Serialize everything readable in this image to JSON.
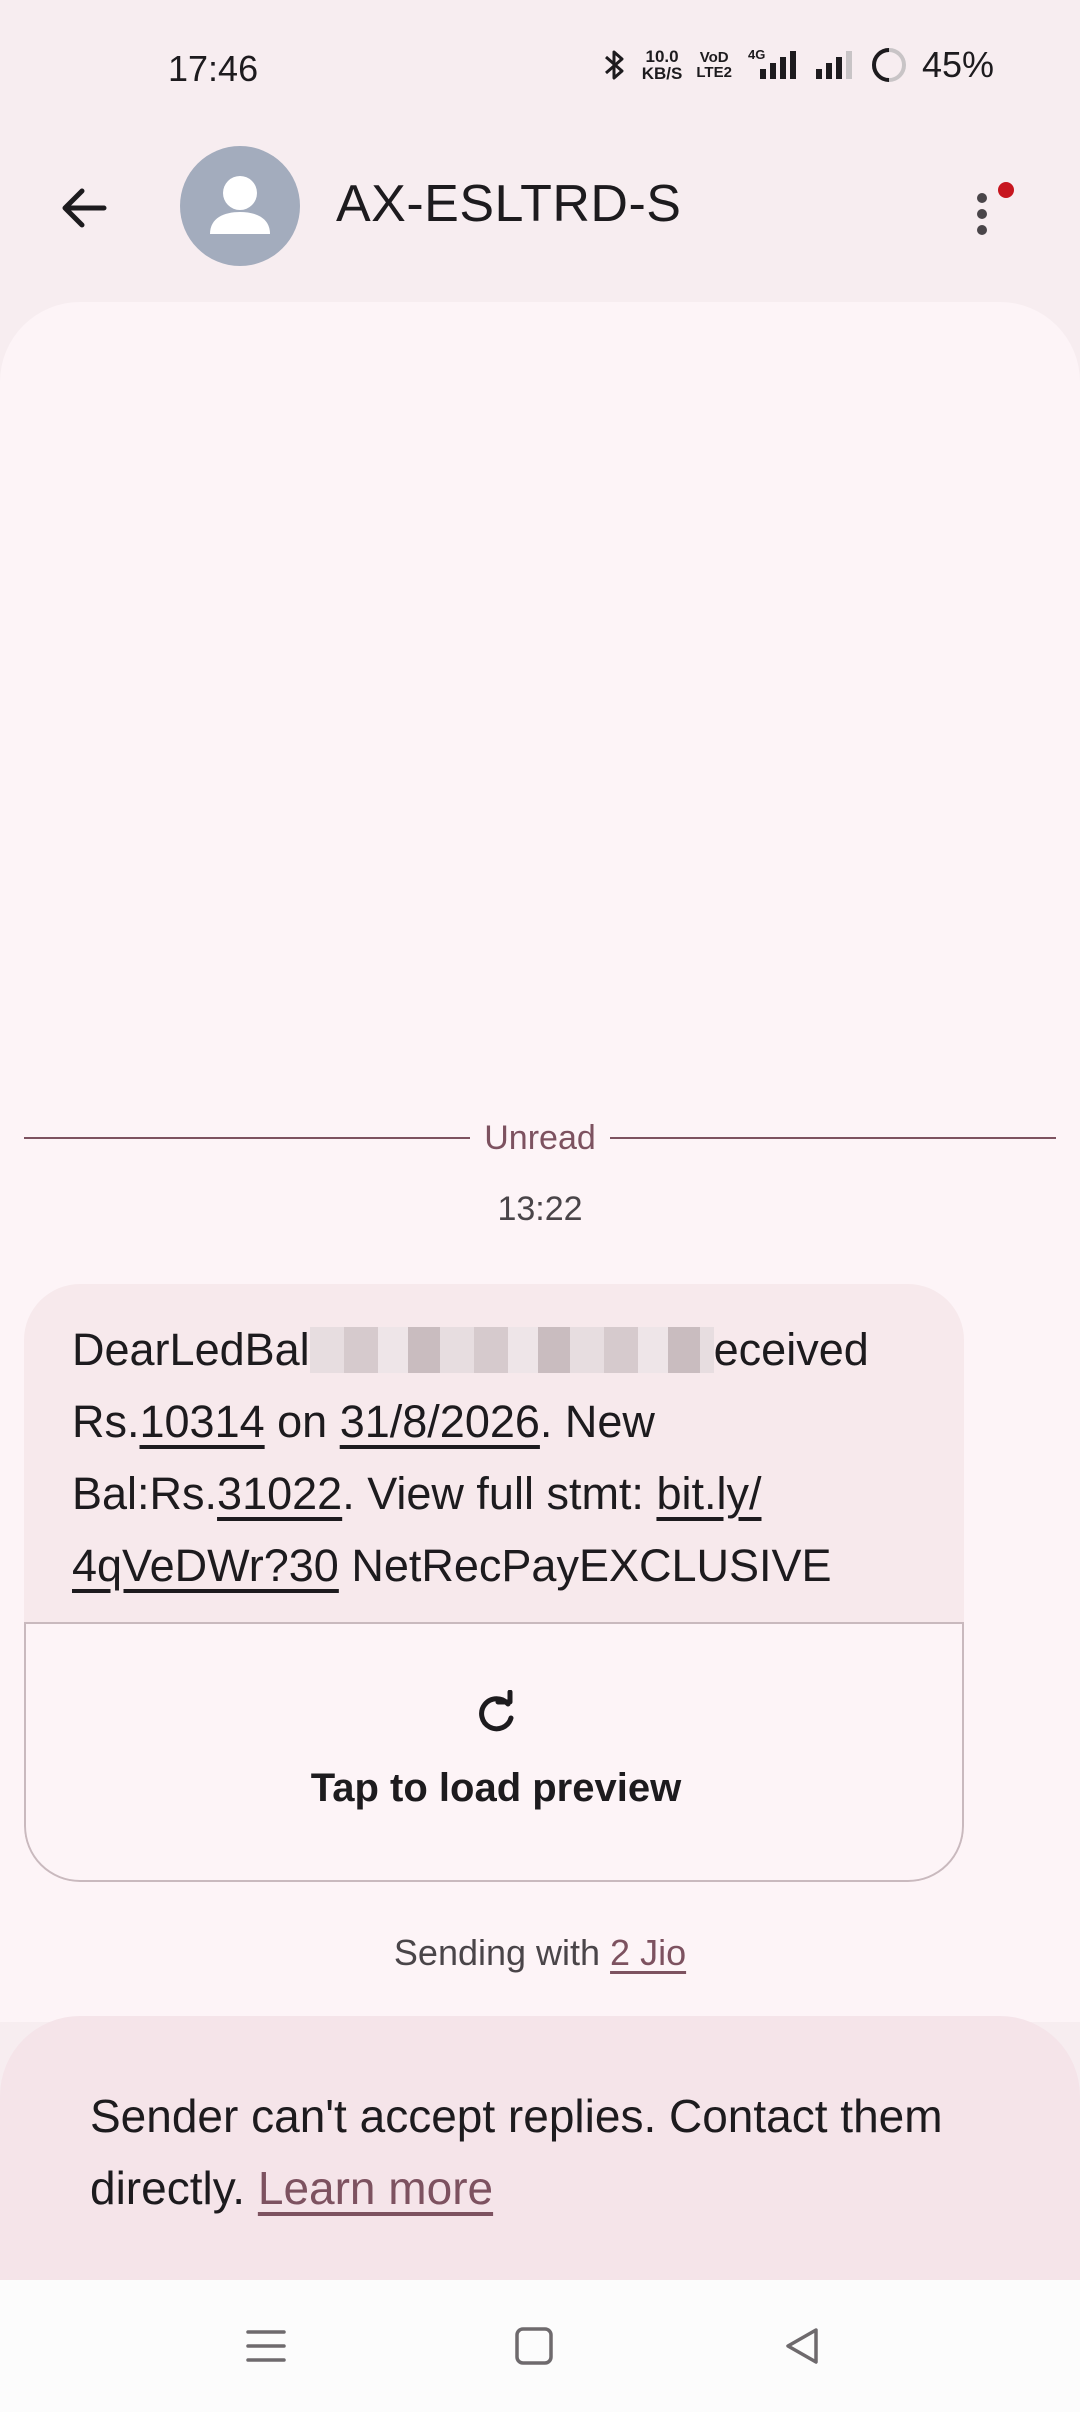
{
  "status_bar": {
    "time": "17:46",
    "net_speed_value": "10.0",
    "net_speed_unit": "KB/S",
    "volte_top": "VoD",
    "volte_bottom": "LTE2",
    "network": "4G",
    "battery": "45%",
    "icons": [
      "bluetooth-icon",
      "signal-sim1-icon",
      "signal-sim2-icon",
      "battery-icon"
    ]
  },
  "app_bar": {
    "title": "AX-ESLTRD-S",
    "has_notification_dot": true,
    "notification_dot_color": "#c7161f"
  },
  "conversation": {
    "unread_label": "Unread",
    "timestamp": "13:22",
    "message": {
      "text_1": "DearLedBal",
      "text_2": "eceived",
      "text_3": "Rs.",
      "amount": "10314",
      "text_4": " on ",
      "date": "31/8/2026",
      "text_5": ". New",
      "text_6": "Bal:Rs.",
      "balance": "31022",
      "text_7": ". View full stmt: ",
      "link_part1": "bit.ly/",
      "link_part2": "4qVeDWr?30",
      "text_8": " NetRecPayEXCLUSIVE"
    },
    "preview": {
      "label": "Tap to load preview"
    },
    "sending": {
      "prefix": "Sending with ",
      "sim": "2 Jio"
    }
  },
  "reply_notice": {
    "text": "Sender can't accept replies. Contact them directly. ",
    "link": "Learn more"
  },
  "colors": {
    "accent": "#7d5260",
    "background": "#f7edf0",
    "panel": "#fdf4f7",
    "avatar": "#a3acbd"
  }
}
